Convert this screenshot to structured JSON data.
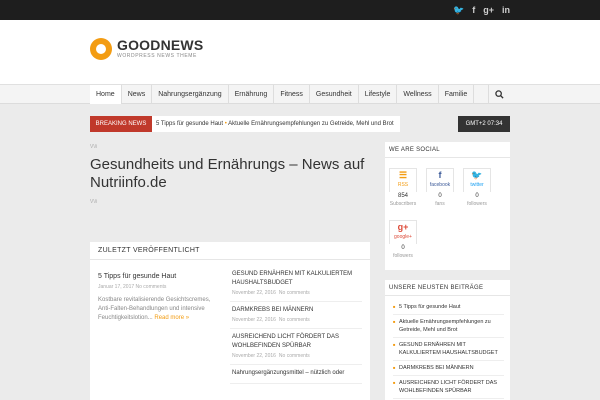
{
  "topbar": {
    "social": [
      "🐦",
      "f",
      "g+",
      "in"
    ]
  },
  "logo": {
    "name": "GOODNEWS",
    "tagline": "WORDPRESS NEWS THEME"
  },
  "nav": {
    "items": [
      "Home",
      "News",
      "Nahrungsergänzung",
      "Ernährung",
      "Fitness",
      "Gesundheit",
      "Lifestyle",
      "Wellness",
      "Familie"
    ],
    "active": "Home"
  },
  "breaking": {
    "label": "BREAKING NEWS",
    "item1": "5 Tipps für gesunde Haut",
    "separator": "•",
    "item2": "Aktuelle Ernährungsempfehlungen zu Getreide, Mehl und Brot"
  },
  "clock": "GMT+2 07:34",
  "page": {
    "meta_top": "V\\/i",
    "title": "Gesundheits und Ernährungs – News auf Nutriinfo.de",
    "meta_bottom": "V\\/i"
  },
  "recent": {
    "title": "ZULETZT VERÖFFENTLICHT",
    "featured": {
      "title": "5 Tipps für gesunde Haut",
      "date": "Januar 17, 2017",
      "comments": "No comments",
      "excerpt": "Kostbare revitalisierende Gesichtscremes, Anti-Falten-Behandlungen und intensive Feuchtigkeitslotion...",
      "read_more": "Read more »"
    },
    "posts": [
      {
        "title": "GESUND ERNÄHREN MIT KALKULIERTEM HAUSHALTSBUDGET",
        "date": "November 22, 2016",
        "comments": "No comments"
      },
      {
        "title": "DARMKREBS BEI MÄNNERN",
        "date": "November 22, 2016",
        "comments": "No comments"
      },
      {
        "title": "AUSREICHEND LICHT FÖRDERT DAS WOHLBEFINDEN SPÜRBAR",
        "date": "November 22, 2016",
        "comments": "No comments"
      },
      {
        "title": "Nahrungsergänzungsmittel – nützlich oder",
        "date": "",
        "comments": ""
      }
    ]
  },
  "social_widget": {
    "title": "WE ARE SOCIAL",
    "counters": [
      {
        "icon": "☰",
        "network": "RSS",
        "count": "854",
        "label": "Subscribers",
        "color": "#f39c12"
      },
      {
        "icon": "f",
        "network": "facebook",
        "count": "0",
        "label": "fans",
        "color": "#3b5998"
      },
      {
        "icon": "🐦",
        "network": "twitter",
        "count": "0",
        "label": "followers",
        "color": "#1da1f2"
      },
      {
        "icon": "g+",
        "network": "google+",
        "count": "0",
        "label": "followers",
        "color": "#dd4b39"
      }
    ]
  },
  "recent_widget": {
    "title": "UNSERE NEUSTEN BEITRÄGE",
    "items": [
      "5 Tipps für gesunde Haut",
      "Aktuelle Ernährungsempfehlungen zu Getreide, Mehl und Brot",
      "GESUND ERNÄHREN MIT KALKULIERTEM HAUSHALTSBUDGET",
      "DARMKREBS BEI MÄNNERN",
      "AUSREICHEND LICHT FÖRDERT DAS WOHLBEFINDEN SPÜRBAR"
    ]
  }
}
